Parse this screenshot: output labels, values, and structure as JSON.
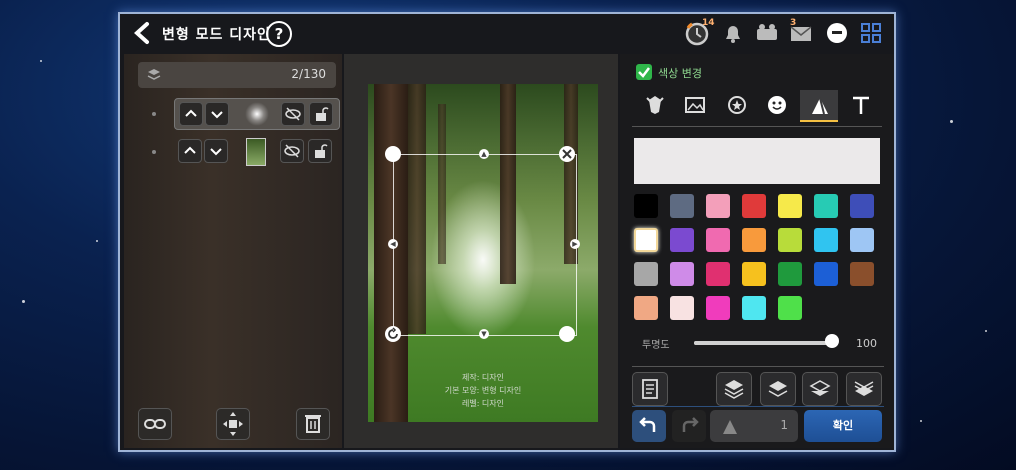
{
  "header": {
    "title": "변형 모드 디자인",
    "help_label": "?",
    "timer_badge": "14",
    "mail_badge": "3"
  },
  "layers": {
    "count": "2/130"
  },
  "canvas": {
    "caption_line1": "제작: 디자인",
    "caption_line2": "기본 모양: 변형 디자인",
    "caption_line3": "레벨: 디자인"
  },
  "editor": {
    "check_label": "색상 변경",
    "opacity_label": "투명도",
    "opacity_value": "100",
    "opacity_fraction": 1.0,
    "stepper_value": "1",
    "confirm_label": "확인"
  },
  "colors": {
    "accent_blue": "#2c66b4",
    "check_green": "#2fb64a",
    "active_tab": "#f5c043",
    "palette": [
      "#000000",
      "#5e6b82",
      "#f39fba",
      "#e03a3a",
      "#f6e94a",
      "#27cbb4",
      "#3e4eb8",
      "#ffffff",
      "#7b4ad0",
      "#f06ab0",
      "#f89a3c",
      "#b8dc3a",
      "#30c4f0",
      "#9ec6f4",
      "#a7a7a7",
      "#cf8be8",
      "#e03070",
      "#f6c11e",
      "#1f9a3d",
      "#1c5fd6",
      "#8a4f2c",
      "#f0a884",
      "#f8e2e2",
      "#f03cbc",
      "#4fe6f0",
      "#4fe04a"
    ]
  }
}
